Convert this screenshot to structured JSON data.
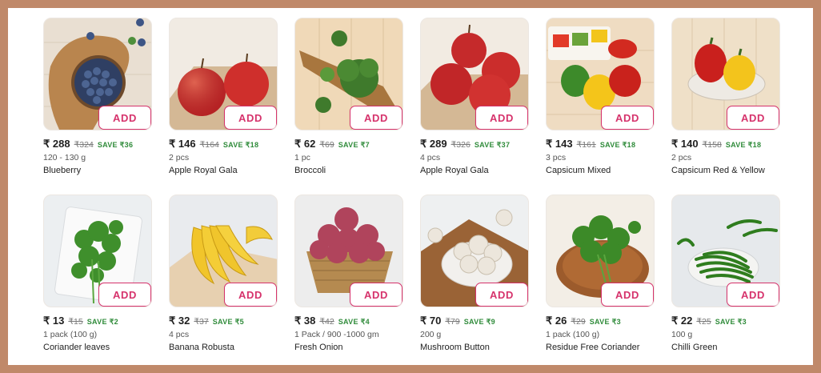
{
  "currency": "₹",
  "add_label": "ADD",
  "products": [
    {
      "price": "288",
      "mrp": "₹324",
      "save": "SAVE ₹36",
      "qty": "120 - 130 g",
      "name": "Blueberry",
      "icon": "blueberry-image"
    },
    {
      "price": "146",
      "mrp": "₹164",
      "save": "SAVE ₹18",
      "qty": "2 pcs",
      "name": "Apple Royal Gala",
      "icon": "apple-image"
    },
    {
      "price": "62",
      "mrp": "₹69",
      "save": "SAVE ₹7",
      "qty": "1 pc",
      "name": "Broccoli",
      "icon": "broccoli-image"
    },
    {
      "price": "289",
      "mrp": "₹326",
      "save": "SAVE ₹37",
      "qty": "4 pcs",
      "name": "Apple Royal Gala",
      "icon": "apple-image"
    },
    {
      "price": "143",
      "mrp": "₹161",
      "save": "SAVE ₹18",
      "qty": "3 pcs",
      "name": "Capsicum Mixed",
      "icon": "capsicum-image"
    },
    {
      "price": "140",
      "mrp": "₹158",
      "save": "SAVE ₹18",
      "qty": "2 pcs",
      "name": "Capsicum Red & Yellow",
      "icon": "capsicum-image"
    },
    {
      "price": "13",
      "mrp": "₹15",
      "save": "SAVE ₹2",
      "qty": "1 pack (100 g)",
      "name": "Coriander leaves",
      "icon": "coriander-image"
    },
    {
      "price": "32",
      "mrp": "₹37",
      "save": "SAVE ₹5",
      "qty": "4 pcs",
      "name": "Banana Robusta",
      "icon": "banana-image"
    },
    {
      "price": "38",
      "mrp": "₹42",
      "save": "SAVE ₹4",
      "qty": "1 Pack / 900 -1000 gm",
      "name": "Fresh Onion",
      "icon": "onion-image"
    },
    {
      "price": "70",
      "mrp": "₹79",
      "save": "SAVE ₹9",
      "qty": "200 g",
      "name": "Mushroom Button",
      "icon": "mushroom-image"
    },
    {
      "price": "26",
      "mrp": "₹29",
      "save": "SAVE ₹3",
      "qty": "1 pack (100 g)",
      "name": "Residue Free Coriander",
      "icon": "coriander-image"
    },
    {
      "price": "22",
      "mrp": "₹25",
      "save": "SAVE ₹3",
      "qty": "100 g",
      "name": "Chilli Green",
      "icon": "chilli-image"
    }
  ],
  "colors": {
    "frame": "#c0896a",
    "accent": "#d6336c",
    "save_green": "#2f8b3a"
  }
}
